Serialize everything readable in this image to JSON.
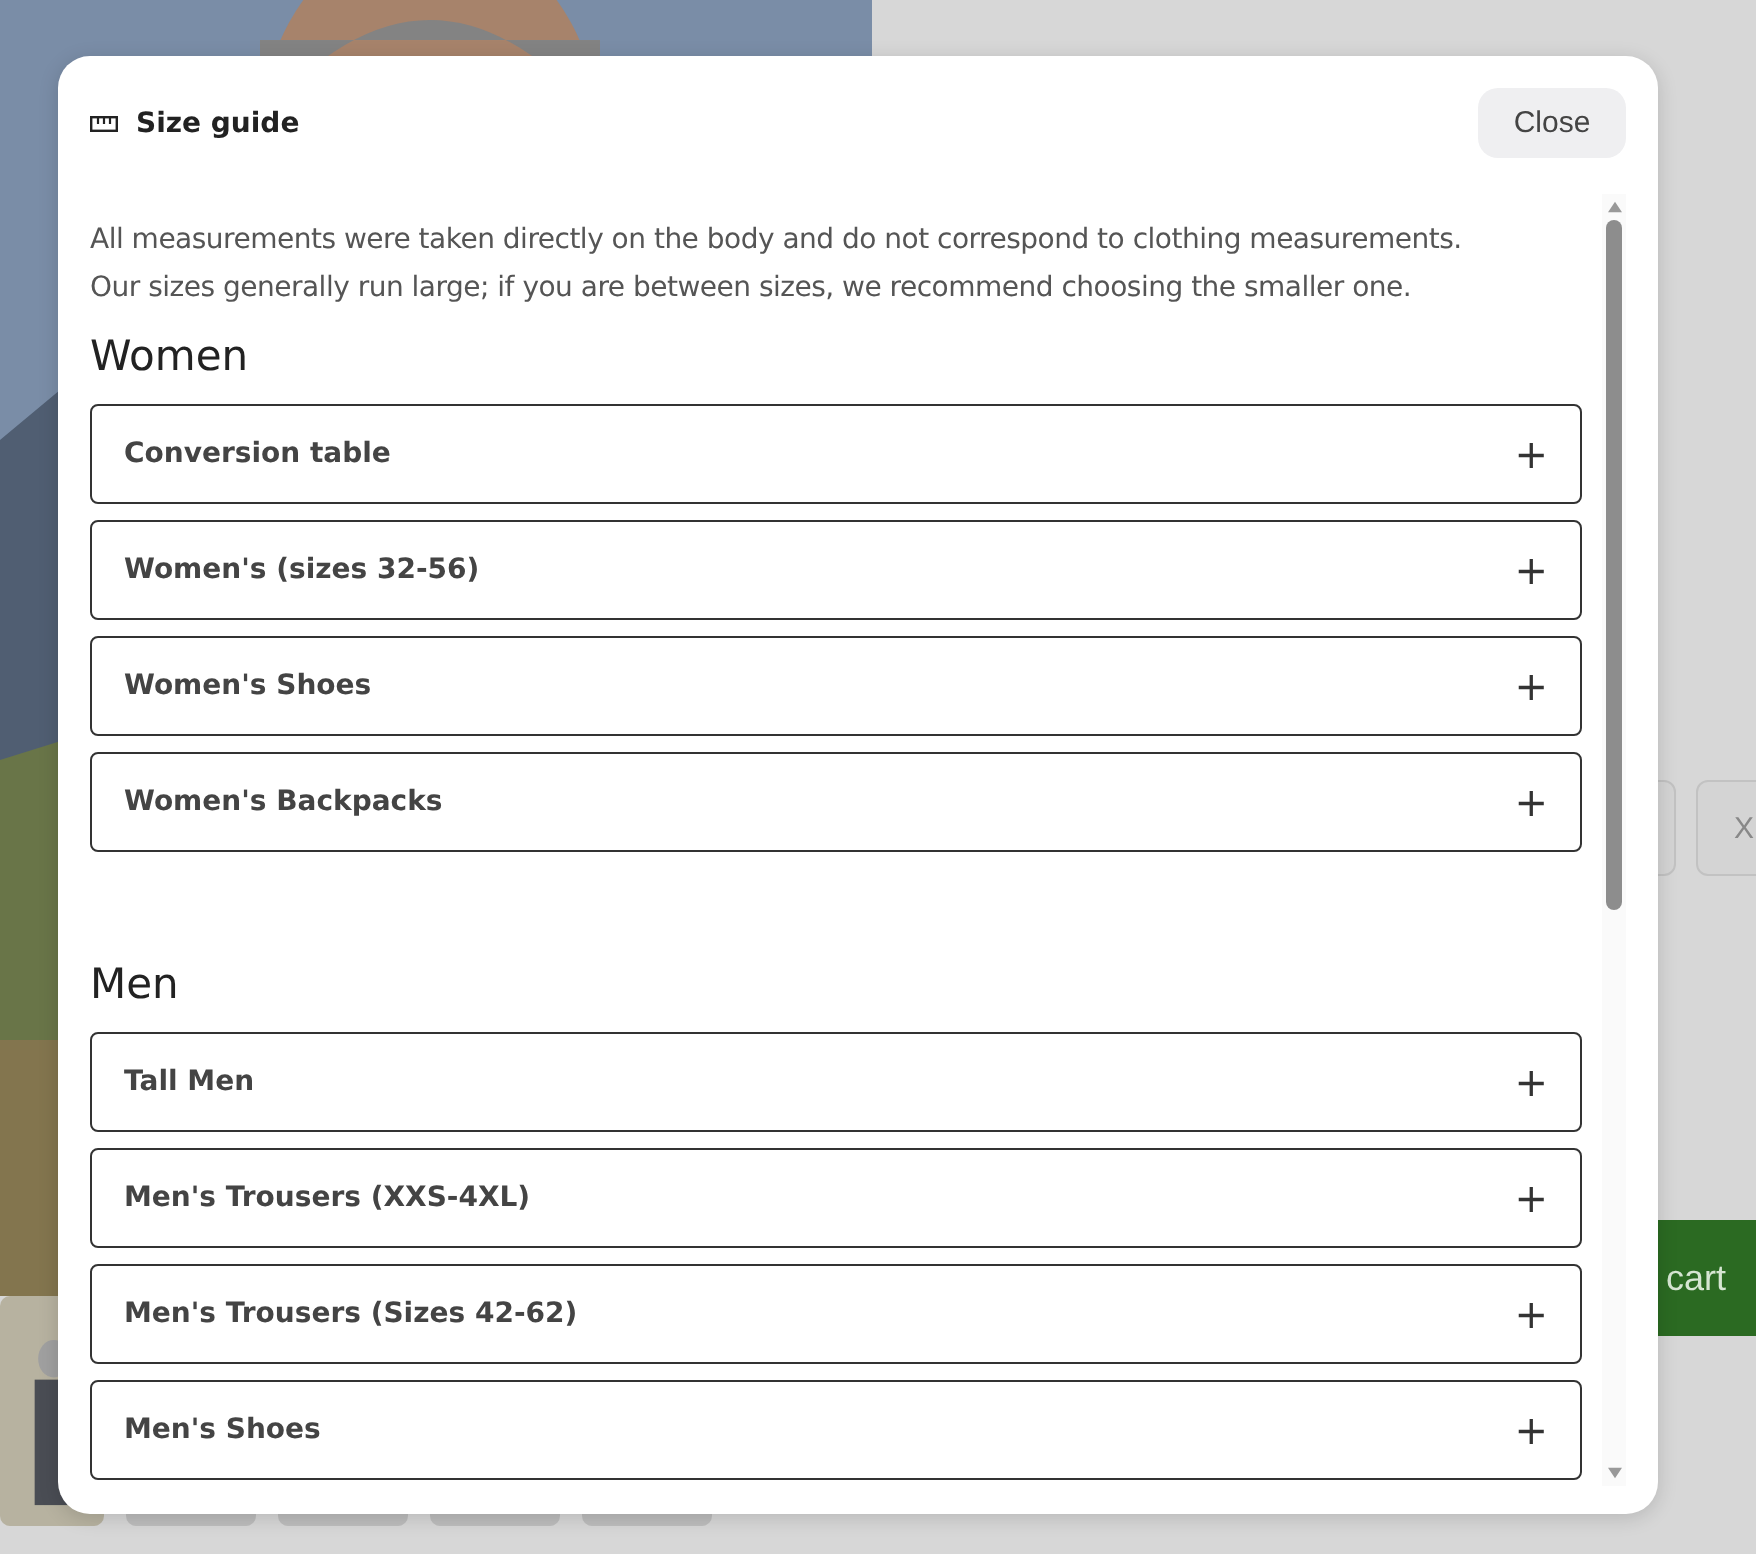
{
  "product_page": {
    "size_options": [
      {
        "label": "X"
      }
    ],
    "cart_button": {
      "label": "cart"
    }
  },
  "dialog": {
    "title": "Size guide",
    "close_label": "Close",
    "intro": [
      "All measurements were taken directly on the body and do not correspond to clothing measurements.",
      "Our sizes generally run large; if you are between sizes, we recommend choosing the smaller one."
    ],
    "sections": [
      {
        "heading": "Women",
        "items": [
          {
            "label": "Conversion table",
            "toggle": "+"
          },
          {
            "label": "Women's (sizes 32-56)",
            "toggle": "+"
          },
          {
            "label": "Women's Shoes",
            "toggle": "+"
          },
          {
            "label": "Women's Backpacks",
            "toggle": "+"
          }
        ]
      },
      {
        "heading": "Men",
        "items": [
          {
            "label": "Tall Men",
            "toggle": "+"
          },
          {
            "label": "Men's Trousers (XXS-4XL)",
            "toggle": "+"
          },
          {
            "label": "Men's Trousers (Sizes 42-62)",
            "toggle": "+"
          },
          {
            "label": "Men's Shoes",
            "toggle": "+"
          }
        ]
      }
    ]
  }
}
